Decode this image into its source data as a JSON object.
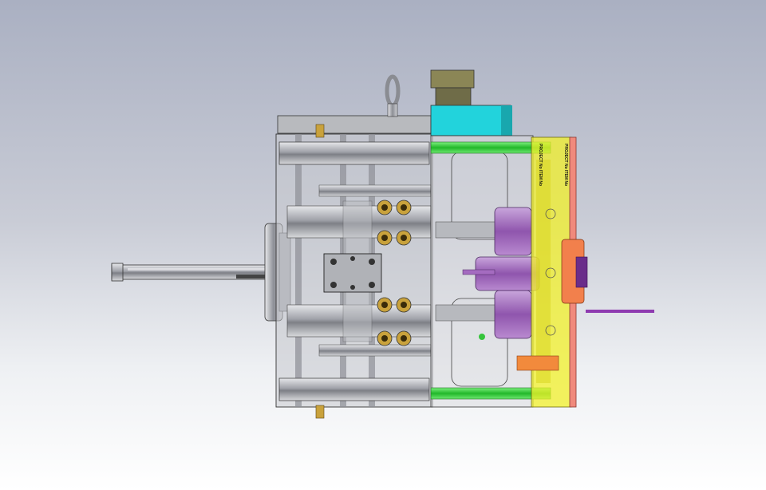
{
  "scene": {
    "type": "cad-assembly-render",
    "subject": "injection mold assembly, side view",
    "colors": {
      "background_top": "#aab0c2",
      "background_bottom": "#ffffff",
      "plate_yellow": "#f2f02a",
      "plate_red": "#f08a7c",
      "cooling_green": "#34d43a",
      "block_cyan": "#22d3dc",
      "insert_purple": "#a46bc0",
      "steel_gray": "#9a9ca3",
      "fitting_brass": "#c9a23c"
    }
  },
  "labels": {
    "plate_text_a": "PROJECT No\nITEM No",
    "plate_text_b": "PROJECT No\nITEM No"
  }
}
